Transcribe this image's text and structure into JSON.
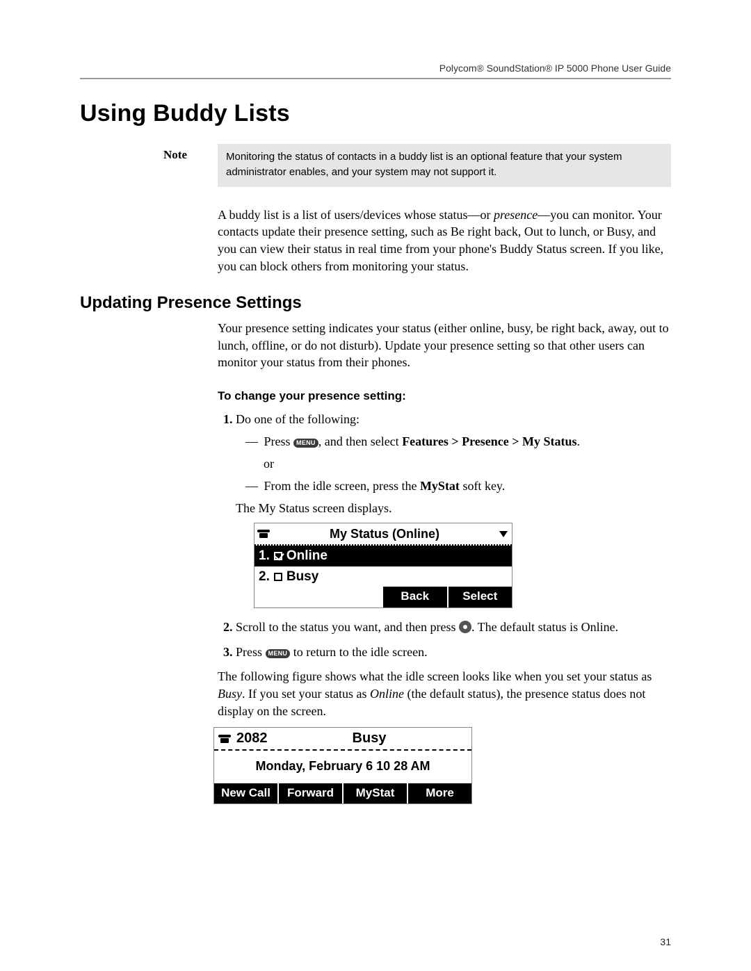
{
  "header": {
    "guide_title": "Polycom® SoundStation® IP 5000 Phone User Guide"
  },
  "section": {
    "title": "Using Buddy Lists"
  },
  "note": {
    "label": "Note",
    "text": "Monitoring the status of contacts in a buddy list is an optional feature that your system administrator enables, and your system may not support it."
  },
  "intro": {
    "p1a": "A buddy list is a list of users/devices whose status—or ",
    "p1_em": "presence",
    "p1b": "—you can monitor. Your contacts update their presence setting, such as Be right back, Out to lunch, or Busy, and you can view their status in real time from your phone's Buddy Status screen. If you like, you can block others from monitoring your status."
  },
  "subsection": {
    "title": "Updating Presence Settings",
    "p1": "Your presence setting indicates your status (either online, busy, be right back, away, out to lunch, offline, or do not disturb). Update your presence setting so that other users can monitor your status from their phones."
  },
  "procedure": {
    "heading": "To change your presence setting:",
    "step1_intro": "Do one of the following:",
    "step1_dash1_a": "Press ",
    "step1_dash1_b": ", and then select ",
    "step1_dash1_bold": "Features > Presence > My Status",
    "step1_dash1_c": ".",
    "step1_or": "or",
    "step1_dash2_a": "From the idle screen, press the ",
    "step1_dash2_bold": "MyStat",
    "step1_dash2_b": " soft key.",
    "step1_result": "The My Status screen displays.",
    "step2_a": "Scroll to the status you want, and then press ",
    "step2_b": ". The default status is Online.",
    "step3_a": "Press ",
    "step3_b": " to return to the idle screen.",
    "after_p_a": "The following figure shows what the idle screen looks like when you set your status as ",
    "after_em1": "Busy",
    "after_p_b": ". If you set your status as ",
    "after_em2": "Online",
    "after_p_c": " (the default status), the presence status does not display on the screen."
  },
  "keys": {
    "menu_label": "MENU"
  },
  "lcd1": {
    "title": "My Status (Online)",
    "row1_index": "1.",
    "row1_label": "Online",
    "row2_index": "2.",
    "row2_label": "Busy",
    "sk_back": "Back",
    "sk_select": "Select"
  },
  "lcd2": {
    "extension": "2082",
    "status": "Busy",
    "dateline": "Monday, February 6   10 28 AM",
    "sk1": "New Call",
    "sk2": "Forward",
    "sk3": "MyStat",
    "sk4": "More"
  },
  "page_number": "31"
}
